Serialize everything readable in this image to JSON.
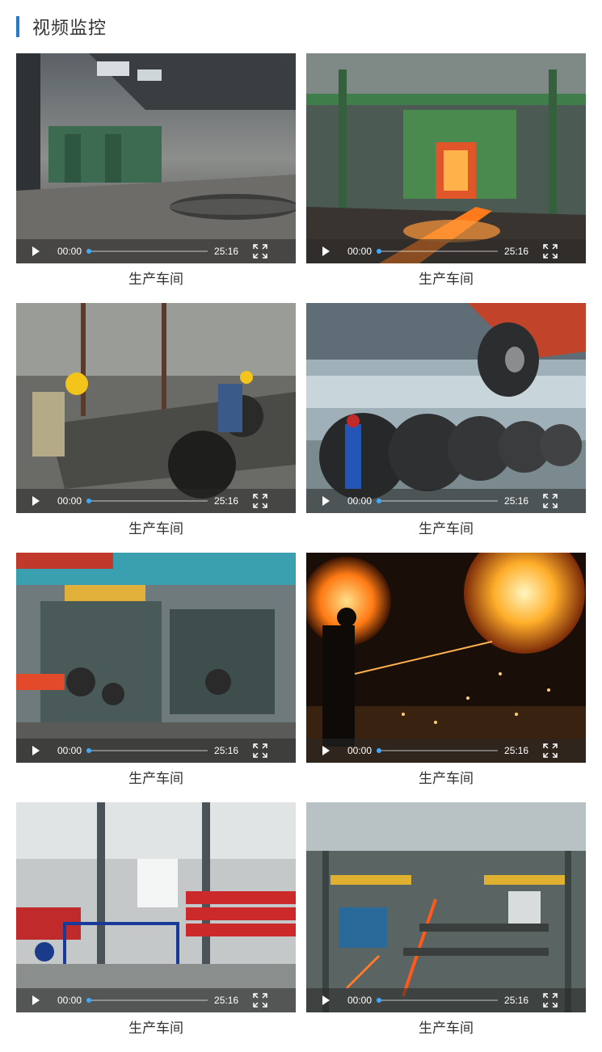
{
  "header": {
    "title": "视频监控"
  },
  "videos": [
    {
      "caption": "生产车间",
      "current": "00:00",
      "duration": "25:16",
      "scene": "mill-hall"
    },
    {
      "caption": "生产车间",
      "current": "00:00",
      "duration": "25:16",
      "scene": "hot-furnace"
    },
    {
      "caption": "生产车间",
      "current": "00:00",
      "duration": "25:16",
      "scene": "worker-machinery"
    },
    {
      "caption": "生产车间",
      "current": "00:00",
      "duration": "25:16",
      "scene": "steel-coils"
    },
    {
      "caption": "生产车间",
      "current": "00:00",
      "duration": "25:16",
      "scene": "rolling-stand"
    },
    {
      "caption": "生产车间",
      "current": "00:00",
      "duration": "25:16",
      "scene": "molten-sparks"
    },
    {
      "caption": "生产车间",
      "current": "00:00",
      "duration": "25:16",
      "scene": "red-racks"
    },
    {
      "caption": "生产车间",
      "current": "00:00",
      "duration": "25:16",
      "scene": "production-line"
    }
  ]
}
